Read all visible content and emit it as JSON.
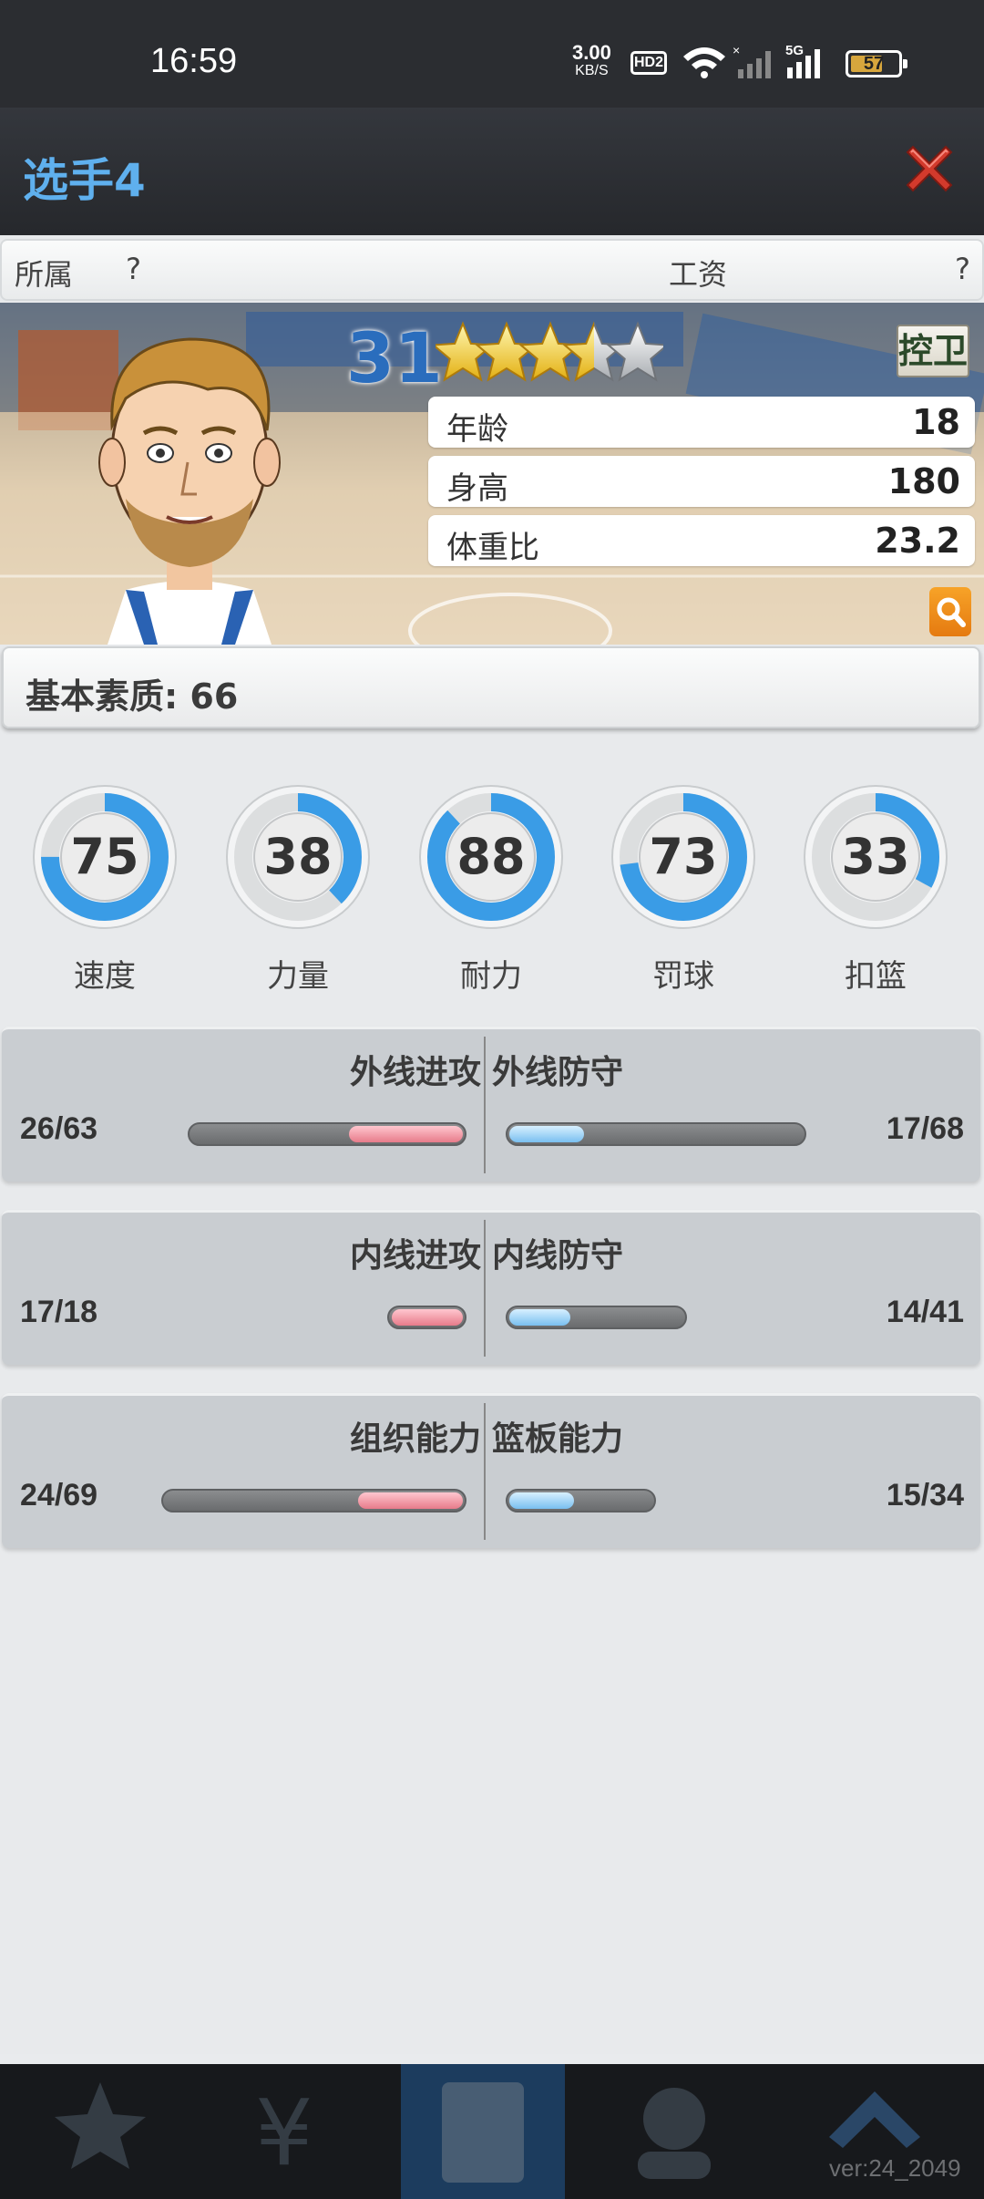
{
  "status_bar": {
    "time": "16:59",
    "net_speed": "3.00",
    "net_unit": "KB/S",
    "hd_label": "HD2",
    "battery": "57"
  },
  "header": {
    "title": "选手4"
  },
  "affiliation": {
    "label": "所属",
    "value": "?",
    "salary_label": "工资",
    "salary_value": "?"
  },
  "player": {
    "overall": "31",
    "stars": 3.5,
    "position": "控卫",
    "info": [
      {
        "label": "年龄",
        "value": "18"
      },
      {
        "label": "身高",
        "value": "180"
      },
      {
        "label": "体重比",
        "value": "23.2"
      }
    ]
  },
  "basic_quality": {
    "label": "基本素质: 66"
  },
  "attributes": [
    {
      "label": "速度",
      "value": 75
    },
    {
      "label": "力量",
      "value": 38
    },
    {
      "label": "耐力",
      "value": 88
    },
    {
      "label": "罚球",
      "value": 73
    },
    {
      "label": "扣篮",
      "value": 33
    }
  ],
  "skills": [
    {
      "left_label": "外线进攻",
      "left_value": "26/63",
      "right_label": "外线防守",
      "right_value": "17/68"
    },
    {
      "left_label": "内线进攻",
      "left_value": "17/18",
      "right_label": "内线防守",
      "right_value": "14/41"
    },
    {
      "left_label": "组织能力",
      "left_value": "24/69",
      "right_label": "篮板能力",
      "right_value": "15/34"
    }
  ],
  "version": "ver:24_2049",
  "colors": {
    "accent_blue": "#5fb0ee",
    "gauge_blue": "#3a9ce6",
    "close_red": "#d33a2c",
    "overall_blue": "#2a6dbd"
  },
  "icons": {
    "close": "close-x-icon",
    "search": "magnifier-icon"
  }
}
